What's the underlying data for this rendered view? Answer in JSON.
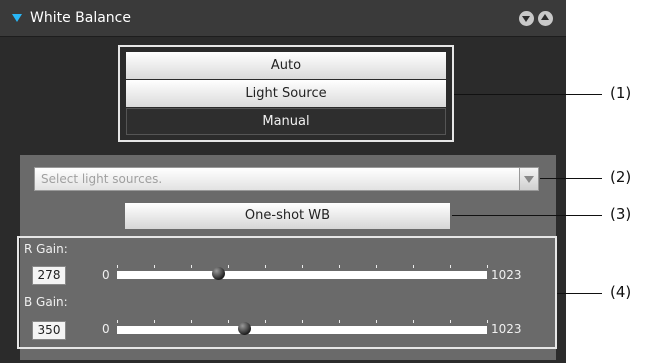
{
  "panel": {
    "title": "White Balance",
    "collapse_icon": "triangle-down-icon",
    "header_buttons": [
      "down-circle-icon",
      "up-circle-icon"
    ]
  },
  "modes": {
    "items": [
      "Auto",
      "Light Source",
      "Manual"
    ],
    "active": "Manual"
  },
  "light_source": {
    "placeholder": "Select light sources."
  },
  "oneshot": {
    "label": "One-shot WB"
  },
  "gains": {
    "r": {
      "label": "R Gain:",
      "value": "278",
      "min": "0",
      "max": "1023",
      "ratio": 0.2717
    },
    "b": {
      "label": "B Gain:",
      "value": "350",
      "min": "0",
      "max": "1023",
      "ratio": 0.3421
    }
  },
  "callouts": [
    "(1)",
    "(2)",
    "(3)",
    "(4)"
  ],
  "colors": {
    "accent": "#29b6f6",
    "panel_bg": "#2b2b2b",
    "group_bg": "#6a6a6a"
  }
}
